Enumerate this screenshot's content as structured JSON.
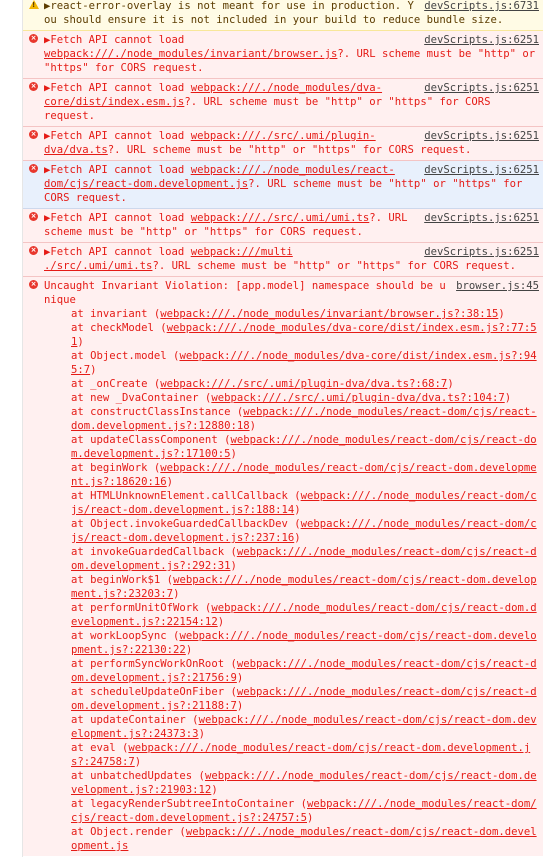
{
  "messages": [
    {
      "level": "warn",
      "source": "devScripts.js:6731",
      "text": "▶react-error-overlay is not meant for use in production. You should ensure it is not included in your build to reduce bundle size."
    },
    {
      "level": "err",
      "source": "devScripts.js:6251",
      "prefix": "▶Fetch API cannot load ",
      "url": "webpack:///./node_modules/invariant/browser.js",
      "suffix": "?. URL scheme must be \"http\" or \"https\" for CORS request."
    },
    {
      "level": "err",
      "source": "devScripts.js:6251",
      "prefix": "▶Fetch API cannot load ",
      "url": "webpack:///./node_modules/dva-core/dist/index.esm.js",
      "suffix": "?. URL scheme must be \"http\" or \"https\" for CORS request."
    },
    {
      "level": "err",
      "source": "devScripts.js:6251",
      "prefix": "▶Fetch API cannot load ",
      "url": "webpack:///./src/.umi/plugin-dva/dva.ts",
      "suffix": "?. URL scheme must be \"http\" or \"https\" for CORS request."
    },
    {
      "level": "err",
      "selected": true,
      "source": "devScripts.js:6251",
      "prefix": "▶Fetch API cannot load ",
      "url": "webpack:///./node_modules/react-dom/cjs/react-dom.development.js",
      "suffix": "?. URL scheme must be \"http\" or \"https\" for CORS request."
    },
    {
      "level": "err",
      "source": "devScripts.js:6251",
      "prefix": "▶Fetch API cannot load ",
      "url": "webpack:///./src/.umi/umi.ts",
      "suffix": "?. URL scheme must be \"http\" or \"https\" for CORS request."
    },
    {
      "level": "err",
      "source": "devScripts.js:6251",
      "prefix": "▶Fetch API cannot load ",
      "url": "webpack:///multi ./src/.umi/umi.ts",
      "suffix": "?. URL scheme must be \"http\" or \"https\" for CORS request."
    }
  ],
  "exception": {
    "source": "browser.js:45",
    "text": "Uncaught Invariant Violation: [app.model] namespace should be unique",
    "frames": [
      {
        "fn": "at invariant (",
        "loc": "webpack:///./node_modules/invariant/browser.js?:38:15",
        "end": ")"
      },
      {
        "fn": "at checkModel (",
        "loc": "webpack:///./node_modules/dva-core/dist/index.esm.js?:77:51",
        "end": ")"
      },
      {
        "fn": "at Object.model (",
        "loc": "webpack:///./node_modules/dva-core/dist/index.esm.js?:945:7",
        "end": ")"
      },
      {
        "fn": "at _onCreate (",
        "loc": "webpack:///./src/.umi/plugin-dva/dva.ts?:68:7",
        "end": ")"
      },
      {
        "fn": "at new _DvaContainer (",
        "loc": "webpack:///./src/.umi/plugin-dva/dva.ts?:104:7",
        "end": ")"
      },
      {
        "fn": "at constructClassInstance (",
        "loc": "webpack:///./node_modules/react-dom/cjs/react-dom.development.js?:12880:18",
        "end": ")"
      },
      {
        "fn": "at updateClassComponent (",
        "loc": "webpack:///./node_modules/react-dom/cjs/react-dom.development.js?:17100:5",
        "end": ")"
      },
      {
        "fn": "at beginWork (",
        "loc": "webpack:///./node_modules/react-dom/cjs/react-dom.development.js?:18620:16",
        "end": ")"
      },
      {
        "fn": "at HTMLUnknownElement.callCallback (",
        "loc": "webpack:///./node_modules/react-dom/cjs/react-dom.development.js?:188:14",
        "end": ")"
      },
      {
        "fn": "at Object.invokeGuardedCallbackDev (",
        "loc": "webpack:///./node_modules/react-dom/cjs/react-dom.development.js?:237:16",
        "end": ")"
      },
      {
        "fn": "at invokeGuardedCallback (",
        "loc": "webpack:///./node_modules/react-dom/cjs/react-dom.development.js?:292:31",
        "end": ")"
      },
      {
        "fn": "at beginWork$1 (",
        "loc": "webpack:///./node_modules/react-dom/cjs/react-dom.development.js?:23203:7",
        "end": ")"
      },
      {
        "fn": "at performUnitOfWork (",
        "loc": "webpack:///./node_modules/react-dom/cjs/react-dom.development.js?:22154:12",
        "end": ")"
      },
      {
        "fn": "at workLoopSync (",
        "loc": "webpack:///./node_modules/react-dom/cjs/react-dom.development.js?:22130:22",
        "end": ")"
      },
      {
        "fn": "at performSyncWorkOnRoot (",
        "loc": "webpack:///./node_modules/react-dom/cjs/react-dom.development.js?:21756:9",
        "end": ")"
      },
      {
        "fn": "at scheduleUpdateOnFiber (",
        "loc": "webpack:///./node_modules/react-dom/cjs/react-dom.development.js?:21188:7",
        "end": ")"
      },
      {
        "fn": "at updateContainer (",
        "loc": "webpack:///./node_modules/react-dom/cjs/react-dom.development.js?:24373:3",
        "end": ")"
      },
      {
        "fn": "at eval (",
        "loc": "webpack:///./node_modules/react-dom/cjs/react-dom.development.js?:24758:7",
        "end": ")"
      },
      {
        "fn": "at unbatchedUpdates (",
        "loc": "webpack:///./node_modules/react-dom/cjs/react-dom.development.js?:21903:12",
        "end": ")"
      },
      {
        "fn": "at legacyRenderSubtreeIntoContainer (",
        "loc": "webpack:///./node_modules/react-dom/cjs/react-dom.development.js?:24757:5",
        "end": ")"
      },
      {
        "fn": "at Object.render (",
        "loc": "webpack:///./node_modules/react-dom/cjs/react-dom.development.js",
        "end": ""
      }
    ]
  },
  "colors": {
    "error_text": "#e51b16",
    "error_bg": "#fff0f0",
    "warning_bg": "#fffbe5",
    "selected_bg": "#e8f0fc"
  }
}
